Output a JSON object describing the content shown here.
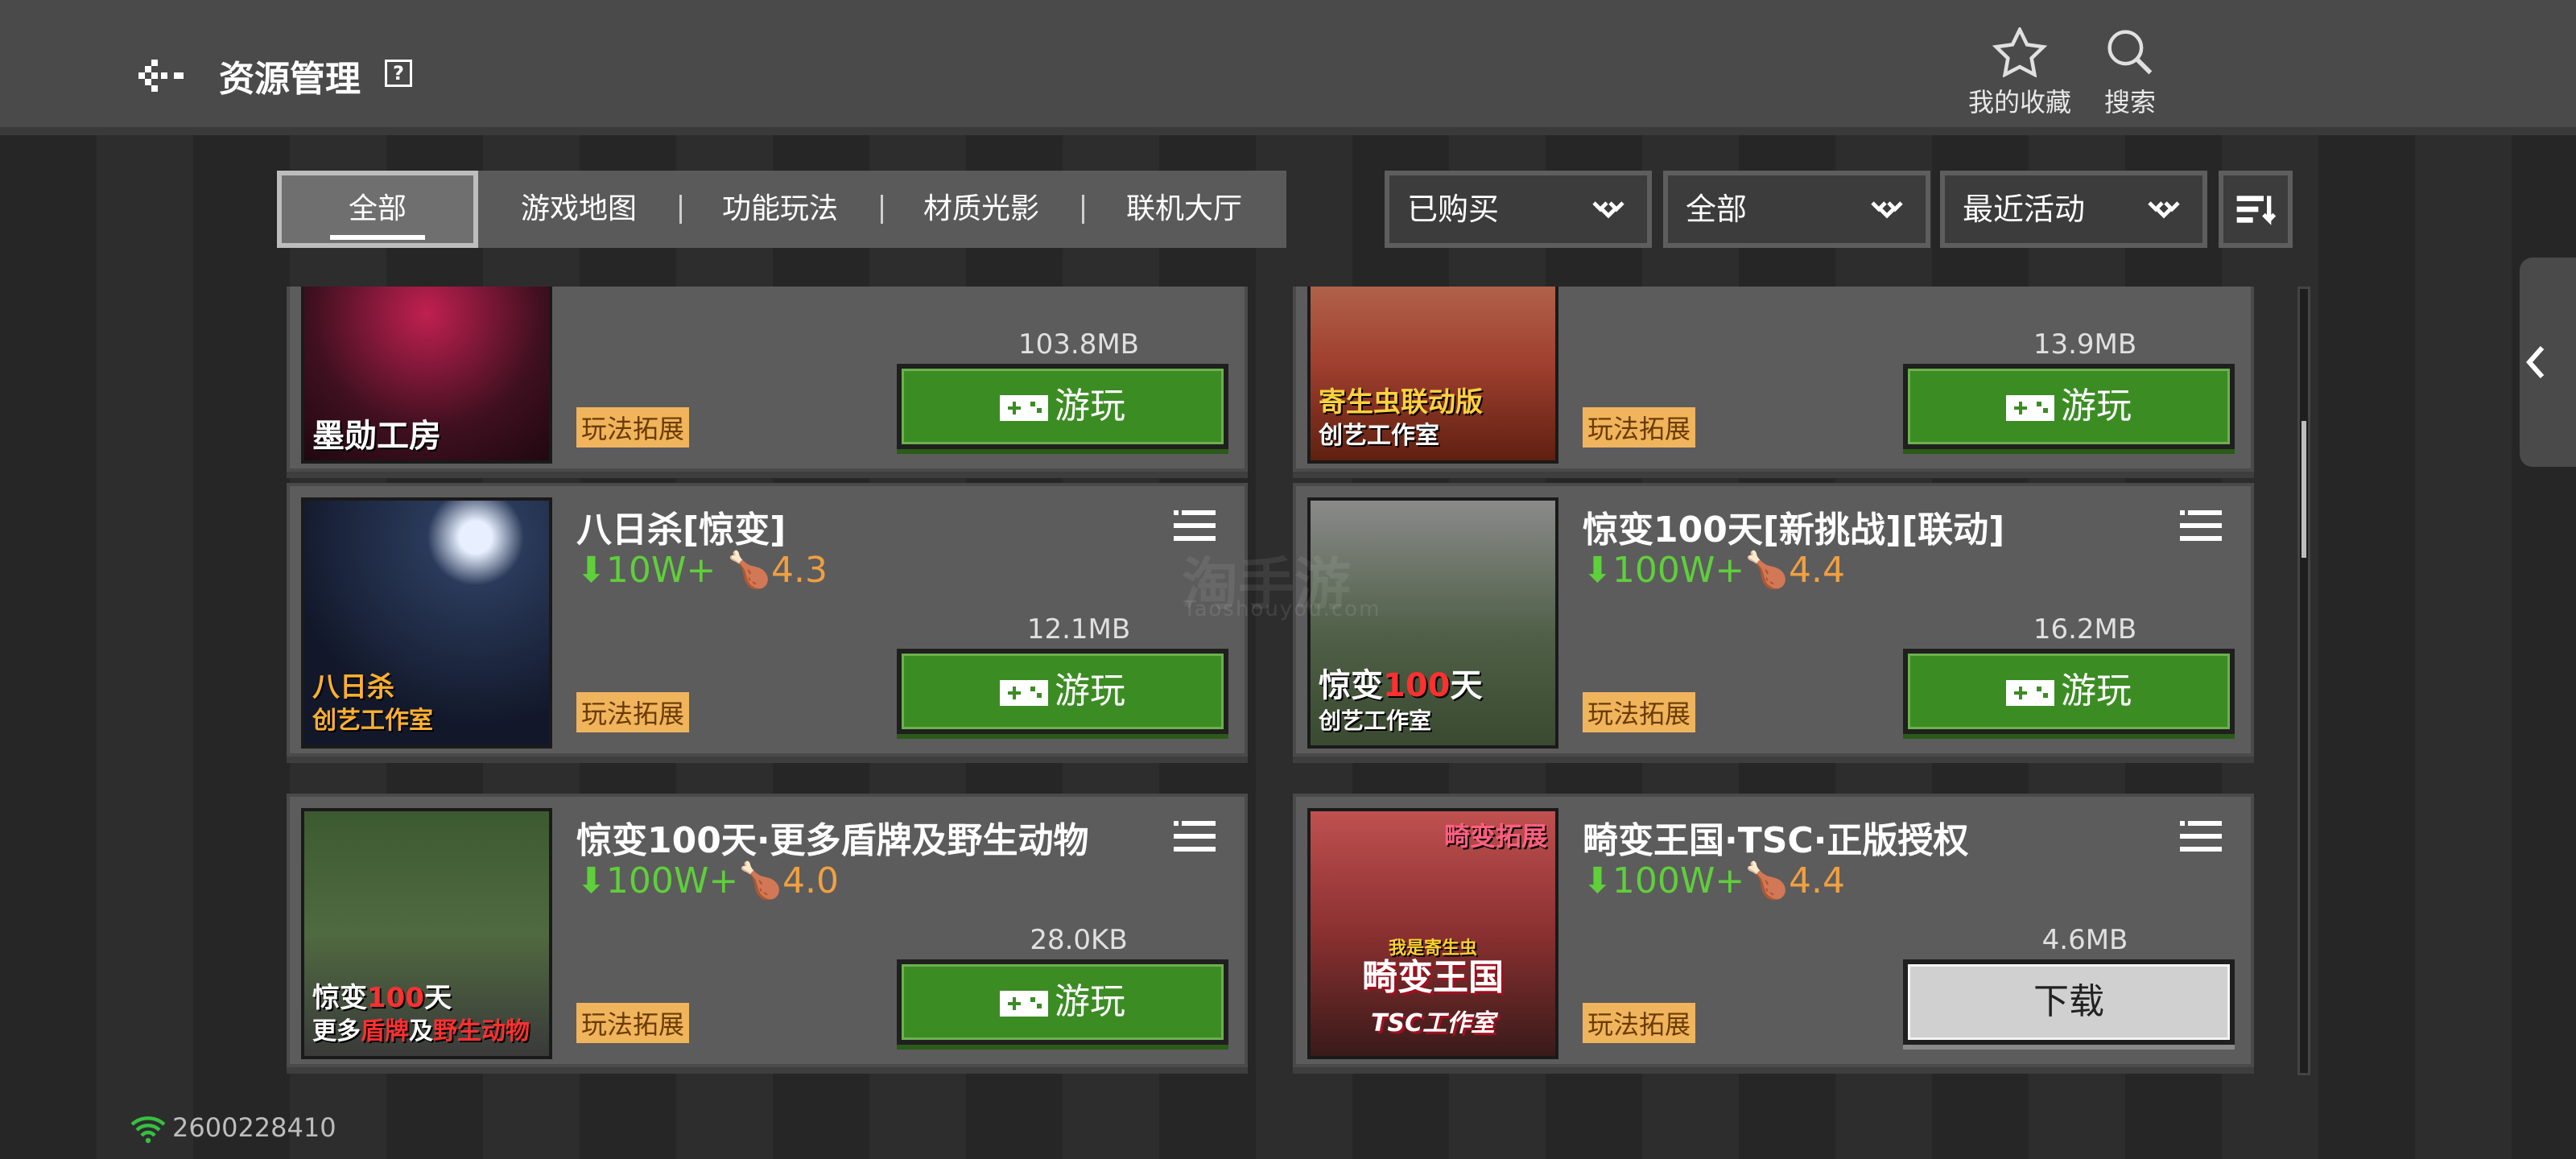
{
  "header": {
    "title": "资源管理",
    "help_label": "?",
    "favorites_label": "我的收藏",
    "search_label": "搜索"
  },
  "tabs": [
    {
      "label": "全部"
    },
    {
      "label": "游戏地图"
    },
    {
      "label": "功能玩法"
    },
    {
      "label": "材质光影"
    },
    {
      "label": "联机大厅"
    }
  ],
  "filters": {
    "purchased": "已购买",
    "category": "全部",
    "sort": "最近活动"
  },
  "cards": [
    {
      "name": "",
      "downloads": "",
      "rating": "",
      "size": "103.8MB",
      "tag": "玩法拓展",
      "action": "游玩",
      "thumb_text": "墨勋工房"
    },
    {
      "name": "",
      "downloads": "",
      "rating": "",
      "size": "13.9MB",
      "tag": "玩法拓展",
      "action": "游玩",
      "thumb_text_1": "寄生虫联动版",
      "thumb_text_2": "创艺工作室"
    },
    {
      "name": "八日杀[惊变]",
      "downloads": "10W+",
      "rating": "4.3",
      "size": "12.1MB",
      "tag": "玩法拓展",
      "action": "游玩",
      "thumb_text_1": "八日杀",
      "thumb_text_2": "创艺工作室"
    },
    {
      "name": "惊变100天[新挑战][联动]",
      "downloads": "100W+",
      "rating": "4.4",
      "size": "16.2MB",
      "tag": "玩法拓展",
      "action": "游玩",
      "thumb_text_1": "惊变",
      "thumb_text_hl": "100",
      "thumb_text_1b": "天",
      "thumb_text_2": "创艺工作室"
    },
    {
      "name": "惊变100天·更多盾牌及野生动物",
      "downloads": "100W+",
      "rating": "4.0",
      "size": "28.0KB",
      "tag": "玩法拓展",
      "action": "游玩",
      "thumb_text_1": "惊变",
      "thumb_text_hl": "100",
      "thumb_text_1b": "天",
      "thumb_text_2a": "更多",
      "thumb_text_2hl": "盾牌",
      "thumb_text_2b": "及",
      "thumb_text_2hl2": "野生动物"
    },
    {
      "name": "畸变王国·TSC·正版授权",
      "downloads": "100W+",
      "rating": "4.4",
      "size": "4.6MB",
      "tag": "玩法拓展",
      "action": "下载",
      "thumb_top": "畸变拓展",
      "thumb_mid": "我是寄生虫",
      "thumb_text_1": "畸变王国",
      "thumb_text_2": "TSC工作室"
    }
  ],
  "status": {
    "user_id": "2600228410"
  },
  "watermark": {
    "line1": "淘手游",
    "line2": "Taoshouyou.com"
  },
  "colors": {
    "play_green": "#3c8c24",
    "download_count": "#5fcf3a",
    "rating": "#f0a040",
    "tag_bg": "#f0b45c"
  }
}
